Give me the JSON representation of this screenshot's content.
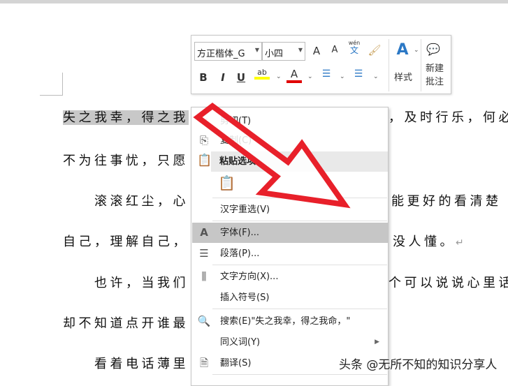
{
  "document": {
    "lines": [
      {
        "left": "失之我幸，得之我",
        "right": "，及时行乐，何必"
      },
      {
        "left": "不为往事忧，只愿",
        "right": ""
      },
      {
        "left": "滚滚红尘，心",
        "right": "能更好的看清楚"
      },
      {
        "left": "自己，理解自己，",
        "right": "没人懂。"
      },
      {
        "left": "也许，当我们",
        "right": "个可以说说心里话"
      },
      {
        "left": "却不知道点开谁最",
        "right": ""
      },
      {
        "left": "看着电话薄里",
        "right": ""
      }
    ],
    "return_mark": "↵"
  },
  "toolbar": {
    "font_name": "方正楷体_G",
    "font_size": "小四",
    "grow_font": "A",
    "shrink_font": "A",
    "phonetic_top": "wén",
    "phonetic_bottom": "文",
    "bold": "B",
    "italic": "I",
    "underline": "U",
    "highlight": "ab",
    "font_color": "A",
    "styles": "样式",
    "new_comment_1": "新建",
    "new_comment_2": "批注",
    "highlight_color": "#ffff00",
    "font_color_value": "#e00000"
  },
  "context_menu": {
    "items": [
      {
        "label": "剪切(T)",
        "icon": "scissors-icon"
      },
      {
        "label": "复制(C)",
        "icon": "copy-icon"
      },
      {
        "label": "粘贴选项:",
        "icon": "paste-icon"
      },
      {
        "label": "汉字重选(V)"
      },
      {
        "label": "字体(F)...",
        "icon": "font-icon"
      },
      {
        "label": "段落(P)...",
        "icon": "paragraph-icon"
      },
      {
        "label": "文字方向(X)...",
        "icon": "text-direction-icon"
      },
      {
        "label": "插入符号(S)"
      },
      {
        "label": "搜索(E)\"失之我幸，得之我命，\"",
        "icon": "search-icon"
      },
      {
        "label": "同义词(Y)"
      },
      {
        "label": "翻译(S)",
        "icon": "translate-icon"
      }
    ]
  },
  "watermark": "头条 @无所不知的知识分享人",
  "colors": {
    "arrow": "#e8202a",
    "highlight_row": "#c6c6c6"
  }
}
